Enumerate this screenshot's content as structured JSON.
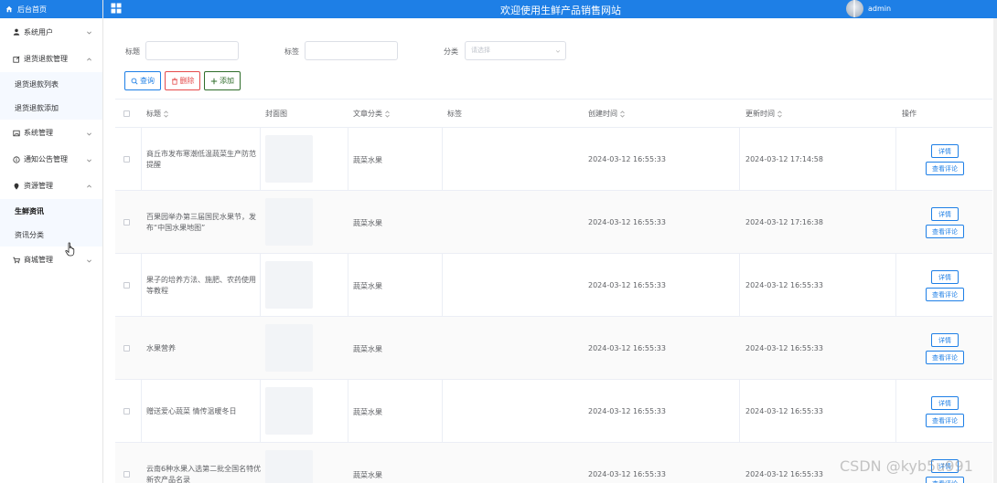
{
  "brand": {
    "label": "后台首页",
    "icon": "home-icon"
  },
  "header": {
    "title": "欢迎使用生鲜产品销售网站",
    "user": "admin",
    "accent": "#1e7fe6"
  },
  "sidebar": {
    "items": [
      {
        "label": "系统用户",
        "icon": "user-icon",
        "expanded": false
      },
      {
        "label": "退货退款管理",
        "icon": "edit-icon",
        "expanded": true,
        "children": [
          "退货退款列表",
          "退货退款添加"
        ]
      },
      {
        "label": "系统管理",
        "icon": "image-icon",
        "expanded": false
      },
      {
        "label": "通知公告管理",
        "icon": "info-icon",
        "expanded": false
      },
      {
        "label": "资源管理",
        "icon": "location-icon",
        "expanded": true,
        "children": [
          "生鲜资讯",
          "资讯分类"
        ]
      },
      {
        "label": "商城管理",
        "icon": "cart-icon",
        "expanded": false
      }
    ],
    "active": "生鲜资讯"
  },
  "filters": {
    "title_label": "标题",
    "tag_label": "标签",
    "category_label": "分类",
    "category_placeholder": "请选择"
  },
  "buttons": {
    "search": "查询",
    "delete": "删除",
    "add": "添加"
  },
  "table": {
    "headers": {
      "title": "标题",
      "cover": "封面图",
      "category": "文章分类",
      "tag": "标签",
      "created": "创建时间",
      "updated": "更新时间",
      "actions": "操作"
    },
    "action_detail": "详情",
    "action_comment": "查看评论",
    "rows": [
      {
        "title": "商丘市发布寒潮低温蔬菜生产防范提醒",
        "category": "蔬菜水果",
        "created": "2024-03-12 16:55:33",
        "updated": "2024-03-12 17:14:58"
      },
      {
        "title": "百果园举办第三届国民水果节，发布“中国水果地图”",
        "category": "蔬菜水果",
        "created": "2024-03-12 16:55:33",
        "updated": "2024-03-12 17:16:38"
      },
      {
        "title": "果子的培养方法、施肥、农药使用等教程",
        "category": "蔬菜水果",
        "created": "2024-03-12 16:55:33",
        "updated": "2024-03-12 16:55:33"
      },
      {
        "title": "水果营养",
        "category": "蔬菜水果",
        "created": "2024-03-12 16:55:33",
        "updated": "2024-03-12 16:55:33"
      },
      {
        "title": "赠送爱心蔬菜 情传温暖冬日",
        "category": "蔬菜水果",
        "created": "2024-03-12 16:55:33",
        "updated": "2024-03-12 16:55:33"
      },
      {
        "title": "云南6种水果入选第二批全国名特优新农产品名录",
        "category": "蔬菜水果",
        "created": "2024-03-12 16:55:33",
        "updated": "2024-03-12 16:55:33"
      }
    ]
  },
  "watermark": "CSDN @kyb5u991"
}
